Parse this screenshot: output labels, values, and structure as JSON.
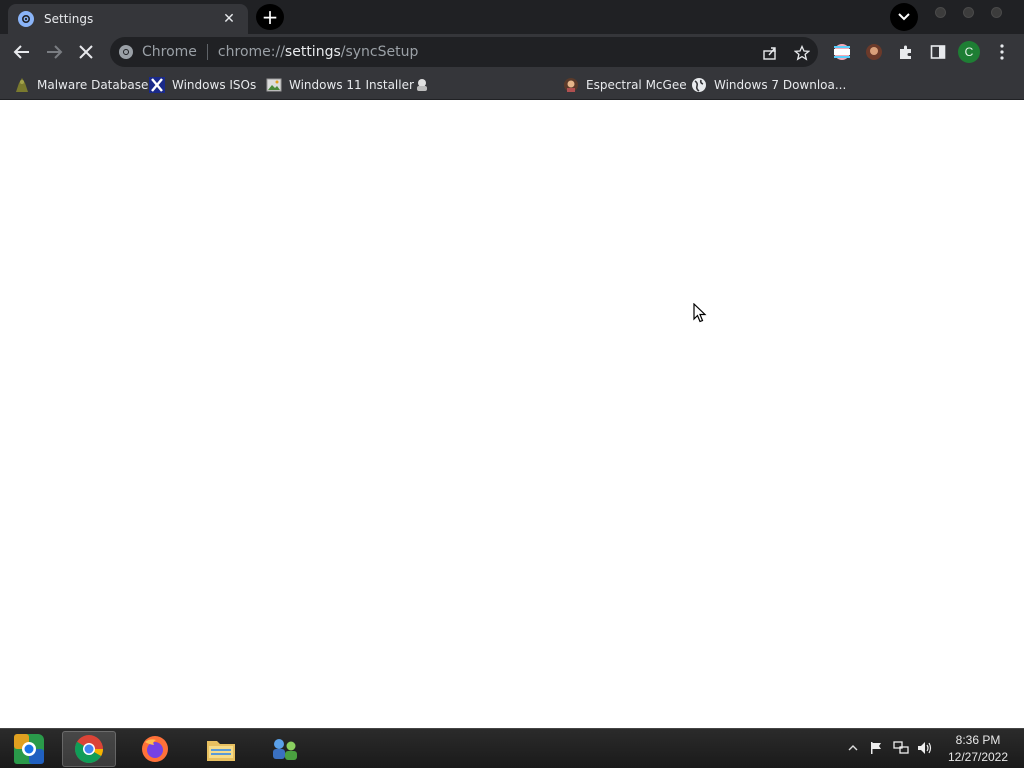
{
  "tab": {
    "title": "Settings",
    "close_glyph": "✕"
  },
  "newtab_glyph": "+",
  "omnibox": {
    "site_chip": "Chrome",
    "url_prefix": "chrome://",
    "url_bold": "settings",
    "url_suffix": "/syncSetup"
  },
  "profile_initial": "C",
  "bookmarks": [
    {
      "label": "Malware Database",
      "icon": "malware-icon"
    },
    {
      "label": "Windows ISOs",
      "icon": "x-icon"
    },
    {
      "label": "Windows 11 Installer",
      "icon": "image-icon"
    },
    {
      "label": "",
      "icon": "site-icon"
    },
    {
      "label": "Espectral McGee",
      "icon": "avatar-icon"
    },
    {
      "label": "Windows 7 Downloa...",
      "icon": "globe-icon"
    }
  ],
  "taskbar": {
    "items": [
      "start-button",
      "chrome-app",
      "firefox-app",
      "file-explorer-app",
      "network-app"
    ],
    "time": "8:36 PM",
    "date": "12/27/2022"
  },
  "colors": {
    "tabstrip": "#202124",
    "toolbar": "#35363a",
    "text": "#e8eaed",
    "profile": "#1e7e34"
  }
}
